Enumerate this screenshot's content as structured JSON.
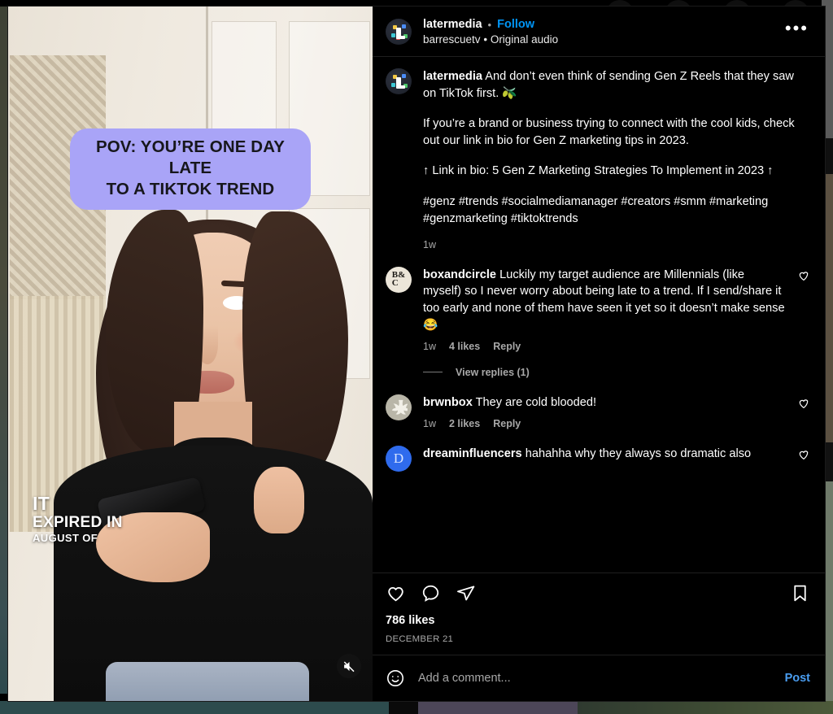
{
  "post": {
    "header": {
      "username": "latermedia",
      "separator": "•",
      "follow_label": "Follow",
      "audio_account": "barrescuetv",
      "audio_separator": "•",
      "audio_label": "Original audio",
      "more_icon": "•••",
      "avatar_name": "latermedia-avatar"
    },
    "caption": {
      "username": "latermedia",
      "paragraphs": [
        "And don’t even think of sending Gen Z Reels that they saw on TikTok first. 🫒",
        "If you’re a brand or business trying to connect with the cool kids, check out our link in bio for Gen Z marketing tips in 2023.",
        "↑ Link in bio: 5 Gen Z Marketing Strategies To Implement in 2023 ↑",
        "#genz #trends #socialmediamanager #creators #smm #marketing #genzmarketing #tiktoktrends"
      ],
      "timestamp": "1w"
    },
    "comments": [
      {
        "username": "boxandcircle",
        "avatar_text": "B&\nC",
        "text": "Luckily my target audience are Millennials (like myself) so I never worry about being late to a trend. If I send/share it too early and none of them have seen it yet so it doesn’t make sense 😂",
        "time": "1w",
        "likes": "4 likes",
        "reply": "Reply",
        "view_replies": "View replies (1)"
      },
      {
        "username": "brwnbox",
        "text": "They are cold blooded!",
        "time": "1w",
        "likes": "2 likes",
        "reply": "Reply"
      },
      {
        "username": "dreaminfluencers",
        "avatar_text": "D",
        "text": "hahahha why they always so dramatic also"
      }
    ],
    "actions": {
      "like_icon": "heart-icon",
      "comment_icon": "comment-icon",
      "share_icon": "share-icon",
      "save_icon": "bookmark-icon",
      "likes_count": "786 likes",
      "date": "DECEMBER 21"
    },
    "compose": {
      "emoji_icon": "emoji-icon",
      "placeholder": "Add a comment...",
      "value": "",
      "post_label": "Post"
    }
  },
  "media": {
    "overlay_caption_line1": "POV: YOU’RE ONE DAY LATE",
    "overlay_caption_line2": "TO A TIKTOK TREND",
    "burned_caption_line1": "IT",
    "burned_caption_line2": "EXPIRED IN",
    "burned_caption_line3": "AUGUST OF",
    "mute_icon": "mute-icon"
  },
  "colors": {
    "accent_blue": "#0095f6",
    "post_blue": "#4a9df0",
    "background": "#000000",
    "muted_text": "#a8a8a8",
    "caption_bubble": "#a9a4f7"
  }
}
